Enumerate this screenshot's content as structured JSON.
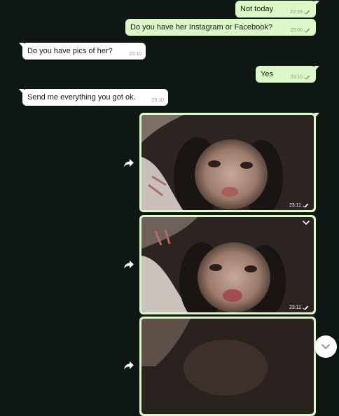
{
  "messages": [
    {
      "text": "Not today",
      "time": "22:59"
    },
    {
      "text": "Do you have her Instagram or Facebook?",
      "time": "23:00"
    },
    {
      "text": "Do you have pics of her?",
      "time": "23:10"
    },
    {
      "text": "Yes",
      "time": "23:10"
    },
    {
      "text": "Send me everything you got ok.",
      "time": "23:10"
    }
  ],
  "photos": [
    {
      "time": "23:11"
    },
    {
      "time": "23:11"
    },
    {
      "time": ""
    }
  ],
  "icons": {
    "read_receipt": "double-check-icon",
    "forward": "forward-arrow-icon",
    "menu": "chevron-down-icon",
    "scroll": "chevron-down-icon"
  },
  "colors": {
    "background": "#0e1714",
    "outgoing_bubble": "#dcf8c6",
    "incoming_bubble": "#ffffff",
    "receipt": "#8a9a88"
  }
}
